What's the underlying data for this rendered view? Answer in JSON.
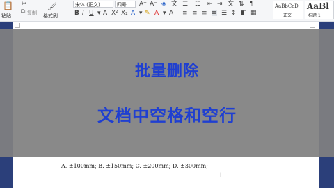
{
  "ribbon": {
    "clipboard": {
      "cut_icon": "scissors-icon",
      "paste_label": "粘贴",
      "copy_label": "复制",
      "format_painter_label": "格式刷"
    },
    "font": {
      "family_value": "宋体 (正文)",
      "size_value": "四号"
    },
    "styles": [
      {
        "sample": "AaBbCcD",
        "label": "正文"
      },
      {
        "sample": "AaBl",
        "label": "标题 1"
      }
    ]
  },
  "overlay": {
    "line1": "批量删除",
    "line2": "文档中空格和空行"
  },
  "document": {
    "options_line": "A. ±100mm;    B. ±150mm;    C. ±200mm;    D. ±300mm;",
    "caret": "I"
  },
  "colors": {
    "title_text": "#1f3fd1",
    "overlay": "#808080",
    "background": "#2b3f7a",
    "ribbon": "#f5f6f8"
  }
}
